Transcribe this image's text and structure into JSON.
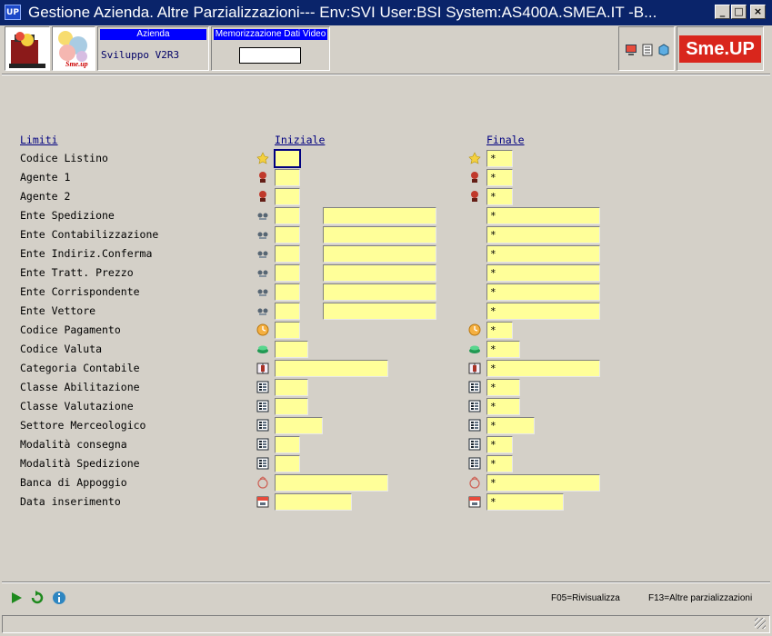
{
  "window": {
    "title": "Gestione Azienda.  Altre Parzializzazioni--- Env:SVI User:BSI System:AS400A.SMEA.IT -B...",
    "app_icon_text": "UP",
    "minimize": "_",
    "maximize": "□",
    "close": "×"
  },
  "toolbar": {
    "azienda_header": "Azienda",
    "azienda_value": "Sviluppo V2R3",
    "memo_header": "Memorizzazione Dati Video",
    "memo_value": "",
    "logo2_text": "Sme.up",
    "smeup_logo": "Sme.UP"
  },
  "form": {
    "col_limiti": "Limiti",
    "col_iniziale": "Iniziale",
    "col_finale": "Finale",
    "rows": [
      {
        "label": "Codice Listino",
        "icon": "star-icon",
        "final": "*"
      },
      {
        "label": "Agente 1",
        "icon": "agent-icon",
        "final": "*"
      },
      {
        "label": "Agente 2",
        "icon": "agent-icon",
        "final": "*"
      },
      {
        "label": "Ente Spedizione",
        "icon": "entity-icon",
        "final": "*"
      },
      {
        "label": "Ente Contabilizzazione",
        "icon": "entity-icon",
        "final": "*"
      },
      {
        "label": "Ente Indiriz.Conferma",
        "icon": "entity-icon",
        "final": "*"
      },
      {
        "label": "Ente Tratt. Prezzo",
        "icon": "entity-icon",
        "final": "*"
      },
      {
        "label": "Ente Corrispondente",
        "icon": "entity-icon",
        "final": "*"
      },
      {
        "label": "Ente Vettore",
        "icon": "entity-icon",
        "final": "*"
      },
      {
        "label": "Codice Pagamento",
        "icon": "clock-icon",
        "final": "*"
      },
      {
        "label": "Codice Valuta",
        "icon": "money-icon",
        "final": "*"
      },
      {
        "label": "Categoria Contabile",
        "icon": "cabinet-icon",
        "final": "*"
      },
      {
        "label": "Classe Abilitazione",
        "icon": "table-icon",
        "final": "*"
      },
      {
        "label": "Classe Valutazione",
        "icon": "table-icon",
        "final": "*"
      },
      {
        "label": "Settore Merceologico",
        "icon": "table-icon",
        "final": "*"
      },
      {
        "label": "Modalità consegna",
        "icon": "table-icon",
        "final": "*"
      },
      {
        "label": "Modalità Spedizione",
        "icon": "table-icon",
        "final": "*"
      },
      {
        "label": "Banca di Appoggio",
        "icon": "bank-icon",
        "final": "*"
      },
      {
        "label": "Data inserimento",
        "icon": "calendar-icon",
        "final": "*"
      }
    ]
  },
  "footer": {
    "f05": "F05=Rivisualizza",
    "f13": "F13=Altre parzializzazioni"
  }
}
